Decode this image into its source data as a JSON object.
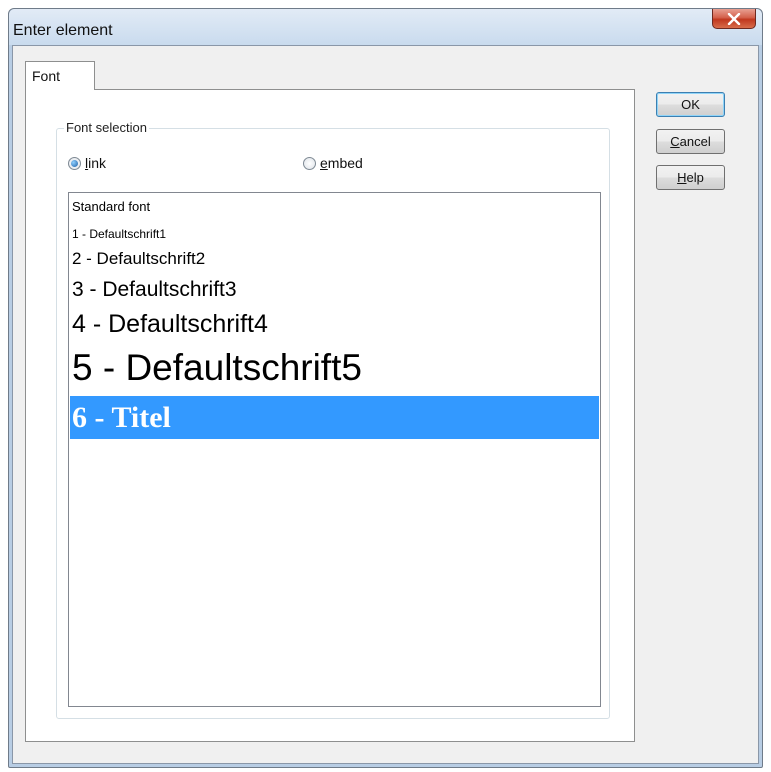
{
  "window": {
    "title": "Enter element"
  },
  "tabs": [
    {
      "label": "Font",
      "selected": true
    }
  ],
  "font_selection": {
    "group_label": "Font selection",
    "radios": [
      {
        "mnemonic": "l",
        "rest": "ink",
        "checked": true
      },
      {
        "mnemonic": "e",
        "rest": "mbed",
        "checked": false
      }
    ],
    "list_items": [
      {
        "label": "Standard font",
        "selected": false
      },
      {
        "label": "1 - Defaultschrift1",
        "selected": false
      },
      {
        "label": "2 - Defaultschrift2",
        "selected": false
      },
      {
        "label": "3 - Defaultschrift3",
        "selected": false
      },
      {
        "label": "4 - Defaultschrift4",
        "selected": false
      },
      {
        "label": "5 - Defaultschrift5",
        "selected": false
      },
      {
        "label": "6 - Titel",
        "selected": true
      }
    ]
  },
  "buttons": {
    "ok": {
      "label": "OK"
    },
    "cancel": {
      "mnemonic": "C",
      "rest": "ancel"
    },
    "help": {
      "mnemonic": "H",
      "rest": "elp"
    }
  },
  "colors": {
    "selection": "#3399ff",
    "close_button": "#c0381f"
  }
}
